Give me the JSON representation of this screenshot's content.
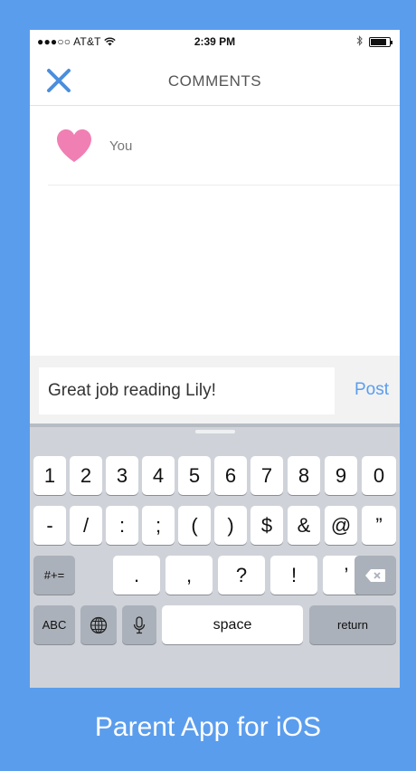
{
  "colors": {
    "brand": "#5b9ded",
    "heart": "#f07fb4",
    "post": "#5b9ded"
  },
  "status": {
    "carrier": "●●●○○ AT&T",
    "time": "2:39 PM",
    "battery_level": 0.85
  },
  "nav": {
    "title": "COMMENTS",
    "close_icon": "close-x-icon"
  },
  "comments": [
    {
      "author": "You",
      "icon": "heart-icon"
    }
  ],
  "compose": {
    "value": "Great job reading Lily!",
    "post_label": "Post"
  },
  "keyboard": {
    "row1": [
      "1",
      "2",
      "3",
      "4",
      "5",
      "6",
      "7",
      "8",
      "9",
      "0"
    ],
    "row2": [
      "-",
      "/",
      ":",
      ";",
      "(",
      ")",
      "$",
      "&",
      "@",
      "”"
    ],
    "row3": {
      "mode": "#+=",
      "keys": [
        ".",
        ",",
        "?",
        "!",
        "’"
      ]
    },
    "row4": {
      "abc": "ABC",
      "space": "space",
      "return": "return"
    }
  },
  "caption": "Parent App for iOS"
}
